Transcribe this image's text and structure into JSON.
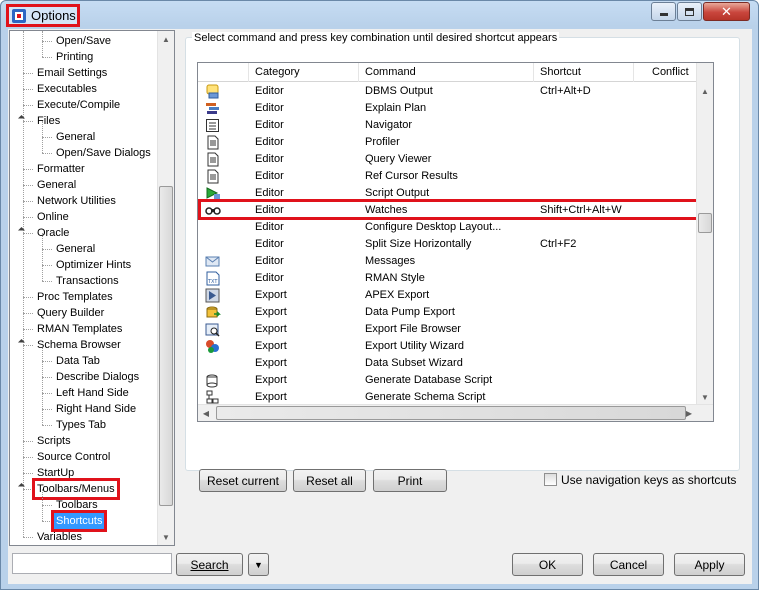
{
  "window": {
    "title": "Options",
    "close_label": "✕"
  },
  "tree": {
    "items": [
      {
        "label": "Open/Save",
        "level": 2
      },
      {
        "label": "Printing",
        "level": 2
      },
      {
        "label": "Email Settings",
        "level": 1
      },
      {
        "label": "Executables",
        "level": 1
      },
      {
        "label": "Execute/Compile",
        "level": 1
      },
      {
        "label": "Files",
        "level": 1,
        "expanded": true
      },
      {
        "label": "General",
        "level": 2
      },
      {
        "label": "Open/Save Dialogs",
        "level": 2
      },
      {
        "label": "Formatter",
        "level": 1
      },
      {
        "label": "General",
        "level": 1
      },
      {
        "label": "Network Utilities",
        "level": 1
      },
      {
        "label": "Online",
        "level": 1
      },
      {
        "label": "Oracle",
        "level": 1,
        "expanded": true
      },
      {
        "label": "General",
        "level": 2
      },
      {
        "label": "Optimizer Hints",
        "level": 2
      },
      {
        "label": "Transactions",
        "level": 2
      },
      {
        "label": "Proc Templates",
        "level": 1
      },
      {
        "label": "Query Builder",
        "level": 1
      },
      {
        "label": "RMAN Templates",
        "level": 1
      },
      {
        "label": "Schema Browser",
        "level": 1,
        "expanded": true
      },
      {
        "label": "Data Tab",
        "level": 2
      },
      {
        "label": "Describe Dialogs",
        "level": 2
      },
      {
        "label": "Left Hand Side",
        "level": 2
      },
      {
        "label": "Right Hand Side",
        "level": 2
      },
      {
        "label": "Types Tab",
        "level": 2
      },
      {
        "label": "Scripts",
        "level": 1
      },
      {
        "label": "Source Control",
        "level": 1
      },
      {
        "label": "StartUp",
        "level": 1
      },
      {
        "label": "Toolbars/Menus",
        "level": 1,
        "expanded": true,
        "highlighted": true
      },
      {
        "label": "Toolbars",
        "level": 2
      },
      {
        "label": "Shortcuts",
        "level": 2,
        "selected": true,
        "highlighted": true
      },
      {
        "label": "Variables",
        "level": 1
      }
    ]
  },
  "shortcuts": {
    "caption": "Select command and press key combination until desired shortcut appears",
    "columns": [
      "Category",
      "Command",
      "Shortcut",
      "Conflict"
    ],
    "rows": [
      {
        "icon": "dbms-output-icon",
        "category": "Editor",
        "command": "DBMS Output",
        "shortcut": "Ctrl+Alt+D"
      },
      {
        "icon": "explain-plan-icon",
        "category": "Editor",
        "command": "Explain Plan",
        "shortcut": ""
      },
      {
        "icon": "navigator-icon",
        "category": "Editor",
        "command": "Navigator",
        "shortcut": ""
      },
      {
        "icon": "profiler-icon",
        "category": "Editor",
        "command": "Profiler",
        "shortcut": ""
      },
      {
        "icon": "query-viewer-icon",
        "category": "Editor",
        "command": "Query Viewer",
        "shortcut": ""
      },
      {
        "icon": "ref-cursor-icon",
        "category": "Editor",
        "command": "Ref Cursor Results",
        "shortcut": ""
      },
      {
        "icon": "script-output-icon",
        "category": "Editor",
        "command": "Script Output",
        "shortcut": ""
      },
      {
        "icon": "watches-icon",
        "category": "Editor",
        "command": "Watches",
        "shortcut": "Shift+Ctrl+Alt+W",
        "highlighted": true
      },
      {
        "icon": "",
        "category": "Editor",
        "command": "Configure Desktop Layout...",
        "shortcut": ""
      },
      {
        "icon": "",
        "category": "Editor",
        "command": "Split Size Horizontally",
        "shortcut": "Ctrl+F2"
      },
      {
        "icon": "messages-icon",
        "category": "Editor",
        "command": "Messages",
        "shortcut": ""
      },
      {
        "icon": "rman-style-icon",
        "category": "Editor",
        "command": "RMAN Style",
        "shortcut": ""
      },
      {
        "icon": "apex-export-icon",
        "category": "Export",
        "command": "APEX Export",
        "shortcut": ""
      },
      {
        "icon": "data-pump-icon",
        "category": "Export",
        "command": "Data Pump Export",
        "shortcut": ""
      },
      {
        "icon": "export-file-browser-icon",
        "category": "Export",
        "command": "Export File Browser",
        "shortcut": ""
      },
      {
        "icon": "export-utility-icon",
        "category": "Export",
        "command": "Export Utility Wizard",
        "shortcut": ""
      },
      {
        "icon": "",
        "category": "Export",
        "command": "Data Subset Wizard",
        "shortcut": ""
      },
      {
        "icon": "gen-db-script-icon",
        "category": "Export",
        "command": "Generate Database Script",
        "shortcut": ""
      },
      {
        "icon": "gen-schema-script-icon",
        "category": "Export",
        "command": "Generate Schema Script",
        "shortcut": ""
      }
    ],
    "reset_current_label": "Reset current",
    "reset_all_label": "Reset all",
    "print_label": "Print",
    "nav_keys_label": "Use navigation keys as shortcuts",
    "nav_keys_checked": false
  },
  "footer": {
    "search_value": "",
    "search_label": "Search",
    "dropdown_glyph": "▼",
    "ok_label": "OK",
    "cancel_label": "Cancel",
    "apply_label": "Apply"
  },
  "colors": {
    "highlight": "#e0121b",
    "selection": "#3399ff"
  }
}
